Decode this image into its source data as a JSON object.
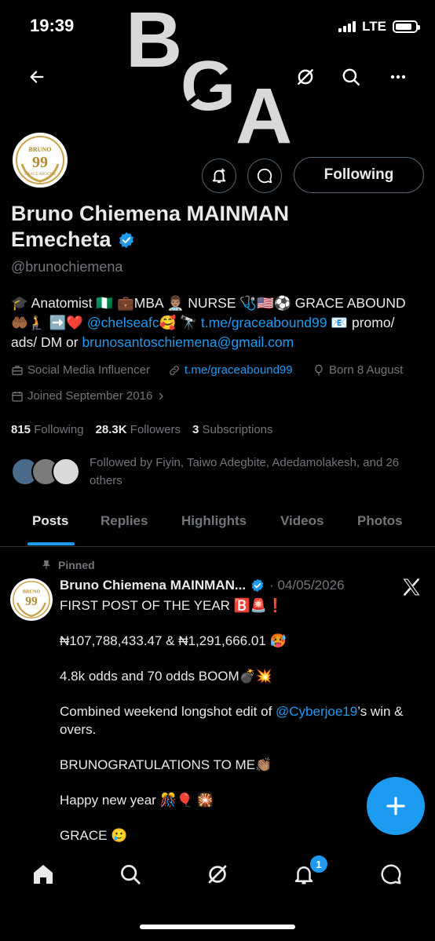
{
  "status_bar": {
    "time": "19:39",
    "network": "LTE"
  },
  "banner": {
    "logo_letters": [
      "B",
      "G",
      "A"
    ]
  },
  "profile": {
    "name_line1": "Bruno Chiemena MAINMAN",
    "name_line2": "Emecheta",
    "handle": "@brunochiemena",
    "following_button": "Following",
    "avatar_text_top": "BRUNO",
    "avatar_text_num": "99",
    "avatar_text_bottom": "GRACE ABOUND",
    "bio": {
      "line1": "🎓 Anatomist 🇳🇬 💼MBA 👨🏽‍⚕️ NURSE 🩺🇺🇸⚽️ GRACE ABOUND",
      "line2_pre": "🤲🏾🧎 ➡️❤️ ",
      "mention": "@chelseafc",
      "line2_mid": "🥰 🔭 ",
      "link": "t.me/graceabound99",
      "line2_post": " 📧 promo/",
      "line3_pre": "ads/ DM or ",
      "email": "brunosantoschiemena@gmail.com"
    },
    "category": "Social Media Influencer",
    "website": "t.me/graceabound99",
    "born": "Born 8 August",
    "joined": "Joined September 2016",
    "following_count": "815",
    "following_label": "Following",
    "followers_count": "28.3K",
    "followers_label": "Followers",
    "subscriptions_count": "3",
    "subscriptions_label": "Subscriptions",
    "followed_by": "Followed by Fiyin, Taiwo Adegbite, Adedamolakesh, and 26 others"
  },
  "tabs": [
    "Posts",
    "Replies",
    "Highlights",
    "Videos",
    "Photos"
  ],
  "post": {
    "pinned_label": "Pinned",
    "author": "Bruno Chiemena MAINMAN...",
    "date": "· 04/05/2026",
    "line1": "FIRST POST OF THE YEAR 🅱️🚨❗",
    "line2": "₦107,788,433.47 & ₦1,291,666.01 🥵",
    "line3": "4.8k odds and 70 odds BOOM💣💥",
    "line4_pre": " Combined weekend longshot edit of ",
    "line4_mention": "@Cyberjoe19",
    "line4_post": "’s win & overs.",
    "line5": "BRUNOGRATULATIONS TO ME👏🏽",
    "line6": "Happy new year 🎊🎈 🎇",
    "line7": "GRACE 🥲"
  },
  "nav": {
    "notifications_badge": "1"
  },
  "colors": {
    "accent": "#1d9bf0",
    "background": "#000000",
    "muted": "#71767b"
  }
}
